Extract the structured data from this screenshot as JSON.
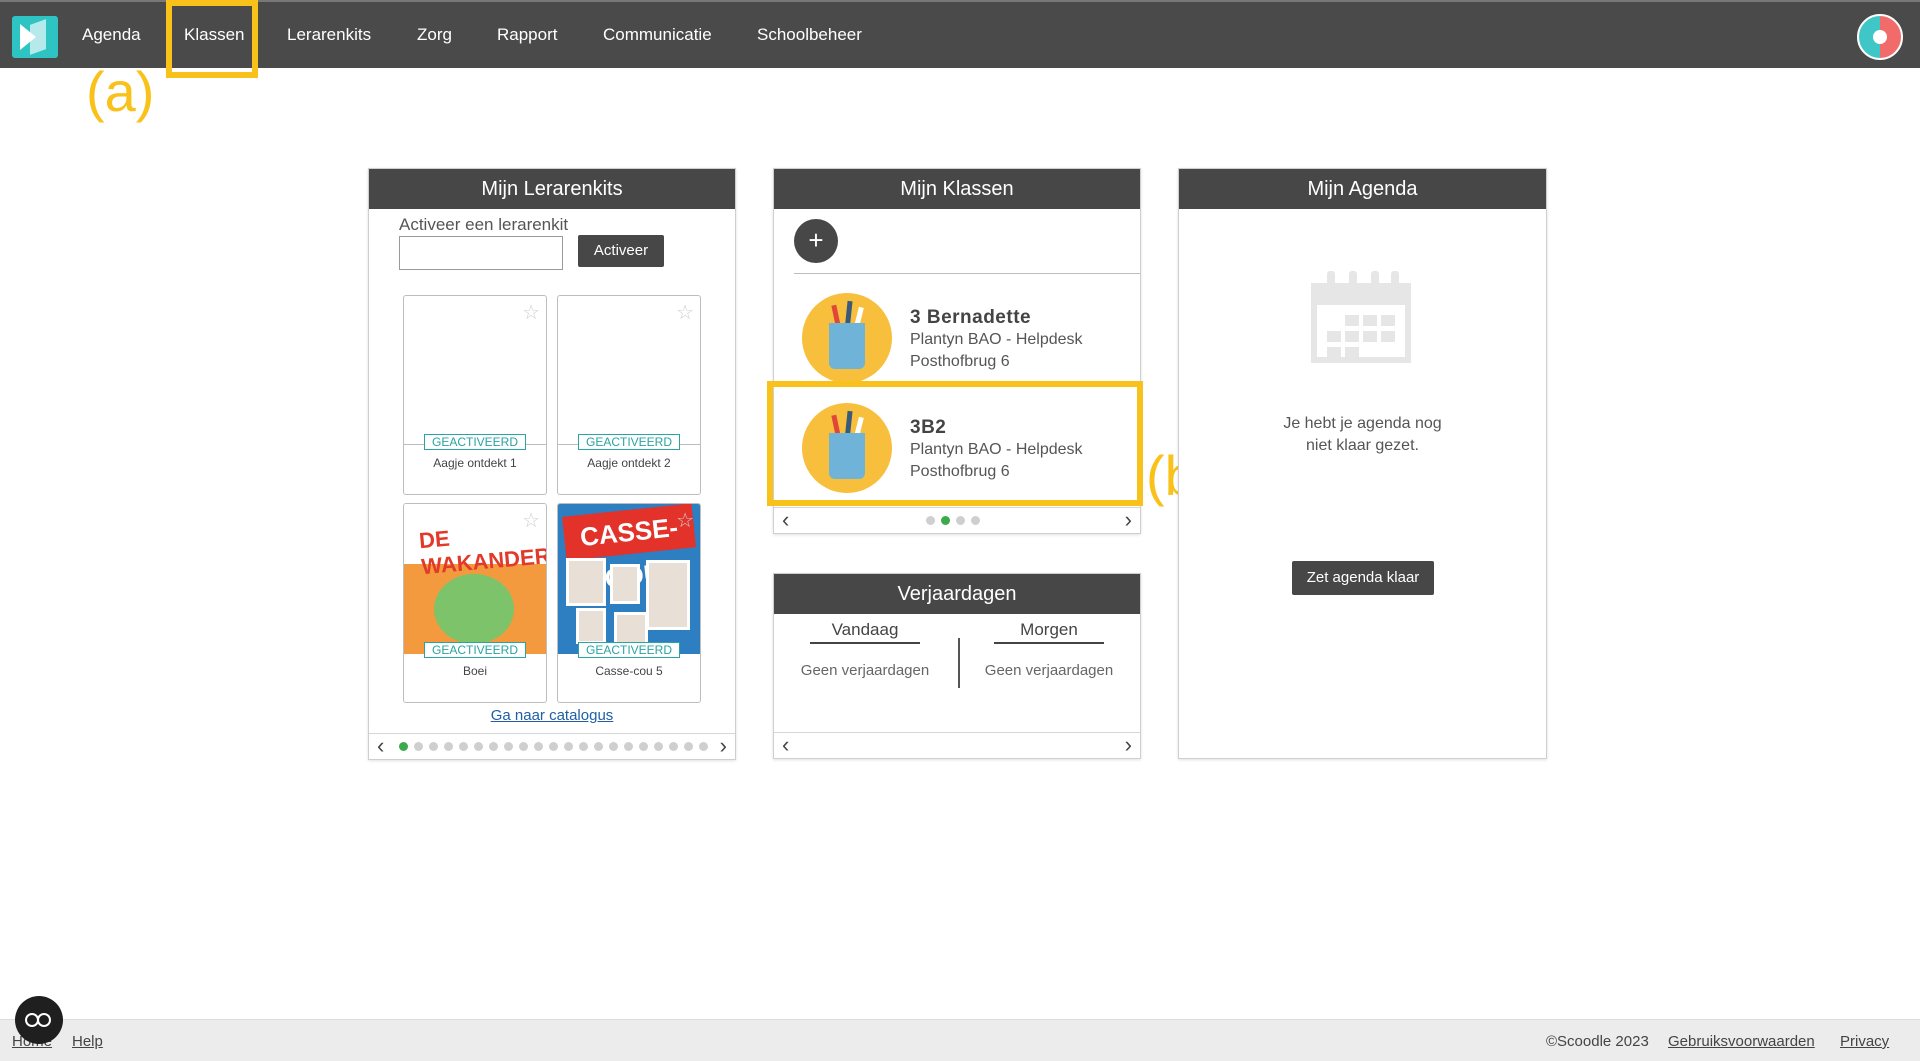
{
  "nav": {
    "items": [
      "Agenda",
      "Klassen",
      "Lerarenkits",
      "Zorg",
      "Rapport",
      "Communicatie",
      "Schoolbeheer"
    ]
  },
  "annotations": {
    "a": "(a)",
    "b": "(b)"
  },
  "lerarenkits": {
    "title": "Mijn Lerarenkits",
    "activate_label": "Activeer een lerarenkit",
    "activate_button": "Activeer",
    "input_value": "",
    "kits": [
      {
        "name": "Aagje ontdekt 1",
        "badge": "GEACTIVEERD"
      },
      {
        "name": "Aagje ontdekt 2",
        "badge": "GEACTIVEERD"
      },
      {
        "name": "Boei",
        "badge": "GEACTIVEERD",
        "cover_title": "DE WAKANDERS ZORG"
      },
      {
        "name": "Casse-cou 5",
        "badge": "GEACTIVEERD",
        "cover_title": "CASSE-COU"
      }
    ],
    "catalog_link": "Ga naar catalogus",
    "pager": {
      "pages": 21,
      "current": 1
    }
  },
  "klassen": {
    "title": "Mijn Klassen",
    "add_label": "+",
    "classes": [
      {
        "name": "3 Bernadette",
        "school": "Plantyn BAO - Helpdesk",
        "address": "Posthofbrug 6"
      },
      {
        "name": "3B2",
        "school": "Plantyn BAO - Helpdesk",
        "address": "Posthofbrug 6"
      }
    ],
    "pager": {
      "pages": 4,
      "current": 2
    }
  },
  "verjaardagen": {
    "title": "Verjaardagen",
    "today_label": "Vandaag",
    "today_text": "Geen verjaardagen",
    "tomorrow_label": "Morgen",
    "tomorrow_text": "Geen verjaardagen"
  },
  "agenda": {
    "title": "Mijn Agenda",
    "empty_line1": "Je hebt je agenda nog",
    "empty_line2": "niet klaar gezet.",
    "button": "Zet agenda klaar"
  },
  "footer": {
    "home": "Home",
    "help": "Help",
    "copyright": "©Scoodle 2023",
    "terms": "Gebruiksvoorwaarden",
    "privacy": "Privacy"
  },
  "colors": {
    "nav_bg": "#4a4a4a",
    "accent_highlight": "#f9c21b",
    "activated_badge": "#2aa3a3",
    "pager_active": "#3aaa4a",
    "class_avatar": "#f7bf3c"
  },
  "icons": [
    "scoodle-logo-icon",
    "user-avatar-icon",
    "star-icon",
    "plus-icon",
    "chevron-left-icon",
    "chevron-right-icon",
    "calendar-icon",
    "accessibility-icon"
  ]
}
